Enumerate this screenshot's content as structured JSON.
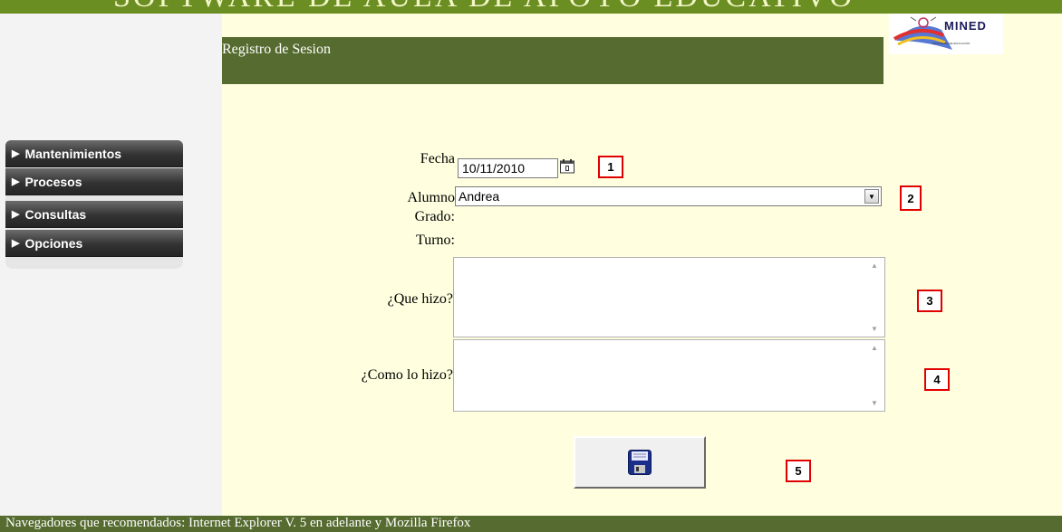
{
  "app": {
    "banner_title": "SOFTWARE DE AULA DE APOYO EDUCATIVO",
    "colors": {
      "header": "#556b2f",
      "banner": "#6b8e23",
      "content_bg": "#ffffe0",
      "badge_border": "#e00000"
    }
  },
  "header": {
    "title": "Registro de Sesion"
  },
  "logo": {
    "name": "MINED",
    "subtitle": "MINISTERIO DE EDUCACION",
    "icon": "mined-logo-icon"
  },
  "sidebar": {
    "items": [
      {
        "label": "Mantenimientos"
      },
      {
        "label": "Procesos"
      },
      {
        "label": "Consultas"
      },
      {
        "label": "Opciones"
      }
    ]
  },
  "form": {
    "fecha": {
      "label": "Fecha",
      "value": "10/11/2010"
    },
    "alumno": {
      "label": "Alumno",
      "value": "Andrea"
    },
    "grado": {
      "label": "Grado:"
    },
    "turno": {
      "label": "Turno:"
    },
    "que_hizo": {
      "label": "¿Que hizo?",
      "value": ""
    },
    "como_lo_hizo": {
      "label": "¿Como lo hizo?",
      "value": ""
    },
    "save_icon": "floppy-disk-icon"
  },
  "badges": [
    "1",
    "2",
    "3",
    "4",
    "5"
  ],
  "footer": {
    "text": "Navegadores que recomendados: Internet Explorer V. 5 en adelante y Mozilla Firefox"
  }
}
